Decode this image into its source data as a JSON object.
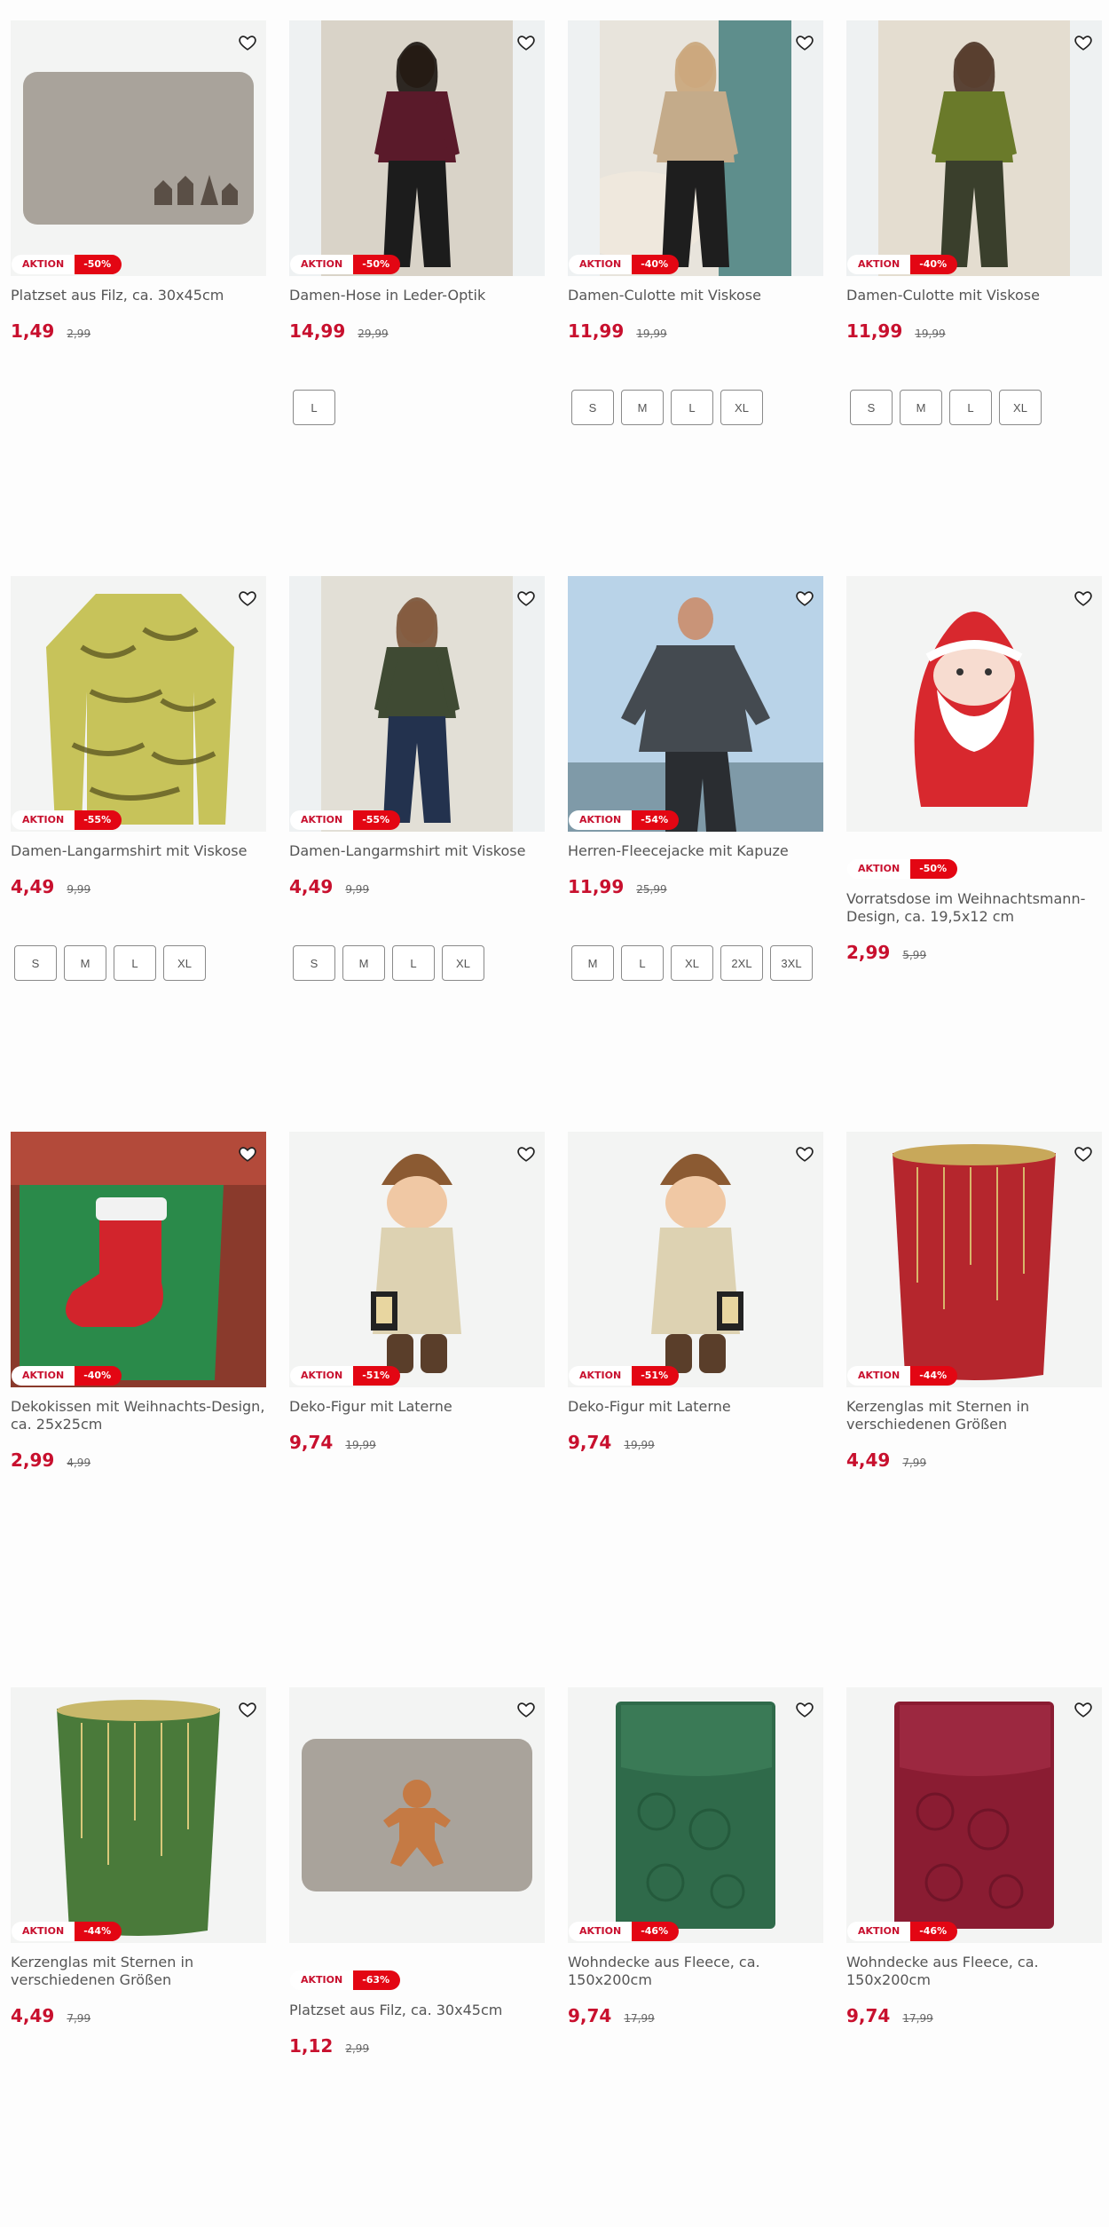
{
  "badge_label": "AKTION",
  "colors": {
    "accent": "#c8102e",
    "discount_bg": "#e30613",
    "text": "#555555"
  },
  "products": [
    {
      "title": "Platzset aus Filz, ca. 30x45cm",
      "price": "1,49",
      "old_price": "2,99",
      "discount": "-50%",
      "image": "felt-placemat-houses",
      "sizes": []
    },
    {
      "title": "Damen-Hose in Leder-Optik",
      "price": "14,99",
      "old_price": "29,99",
      "discount": "-50%",
      "image": "woman-leather-pants",
      "sizes": [
        "L"
      ]
    },
    {
      "title": "Damen-Culotte mit Viskose",
      "price": "11,99",
      "old_price": "19,99",
      "discount": "-40%",
      "image": "woman-beige-sweater",
      "sizes": [
        "S",
        "M",
        "L",
        "XL"
      ]
    },
    {
      "title": "Damen-Culotte mit Viskose",
      "price": "11,99",
      "old_price": "19,99",
      "discount": "-40%",
      "image": "woman-green-culotte",
      "sizes": [
        "S",
        "M",
        "L",
        "XL"
      ]
    },
    {
      "title": "Damen-Langarmshirt mit Viskose",
      "price": "4,49",
      "old_price": "9,99",
      "discount": "-55%",
      "image": "zebra-print-shirt",
      "sizes": [
        "S",
        "M",
        "L",
        "XL"
      ]
    },
    {
      "title": "Damen-Langarmshirt mit Viskose",
      "price": "4,49",
      "old_price": "9,99",
      "discount": "-55%",
      "image": "woman-green-shirt",
      "sizes": [
        "S",
        "M",
        "L",
        "XL"
      ]
    },
    {
      "title": "Herren-Fleecejacke mit Kapuze",
      "price": "11,99",
      "old_price": "25,99",
      "discount": "-54%",
      "image": "man-fleece-jacket",
      "sizes": [
        "M",
        "L",
        "XL",
        "2XL",
        "3XL"
      ]
    },
    {
      "title": "Vorratsdose im Weihnachtsmann-Design, ca. 19,5x12 cm",
      "price": "2,99",
      "old_price": "5,99",
      "discount": "-50%",
      "image": "santa-tin",
      "sizes": [],
      "badge_below": true
    },
    {
      "title": "Dekokissen mit Weihnachts-Design, ca. 25x25cm",
      "price": "2,99",
      "old_price": "4,99",
      "discount": "-40%",
      "image": "stocking-cushion",
      "sizes": []
    },
    {
      "title": "Deko-Figur mit Laterne",
      "price": "9,74",
      "old_price": "19,99",
      "discount": "-51%",
      "image": "figure-lantern-right",
      "sizes": []
    },
    {
      "title": "Deko-Figur mit Laterne",
      "price": "9,74",
      "old_price": "19,99",
      "discount": "-51%",
      "image": "figure-lantern-left",
      "sizes": []
    },
    {
      "title": "Kerzenglas mit Sternen in verschiedenen Größen",
      "price": "4,49",
      "old_price": "7,99",
      "discount": "-44%",
      "image": "red-candle-glass",
      "sizes": []
    },
    {
      "title": "Kerzenglas mit Sternen in verschiedenen Größen",
      "price": "4,49",
      "old_price": "7,99",
      "discount": "-44%",
      "image": "green-candle-glass",
      "sizes": []
    },
    {
      "title": "Platzset aus Filz, ca. 30x45cm",
      "price": "1,12",
      "old_price": "2,99",
      "discount": "-63%",
      "image": "felt-placemat-gingerbread",
      "sizes": [],
      "badge_below": true
    },
    {
      "title": "Wohndecke aus Fleece, ca. 150x200cm",
      "price": "9,74",
      "old_price": "17,99",
      "discount": "-46%",
      "image": "green-fleece-blanket",
      "sizes": []
    },
    {
      "title": "Wohndecke aus Fleece, ca. 150x200cm",
      "price": "9,74",
      "old_price": "17,99",
      "discount": "-46%",
      "image": "red-fleece-blanket",
      "sizes": []
    }
  ]
}
